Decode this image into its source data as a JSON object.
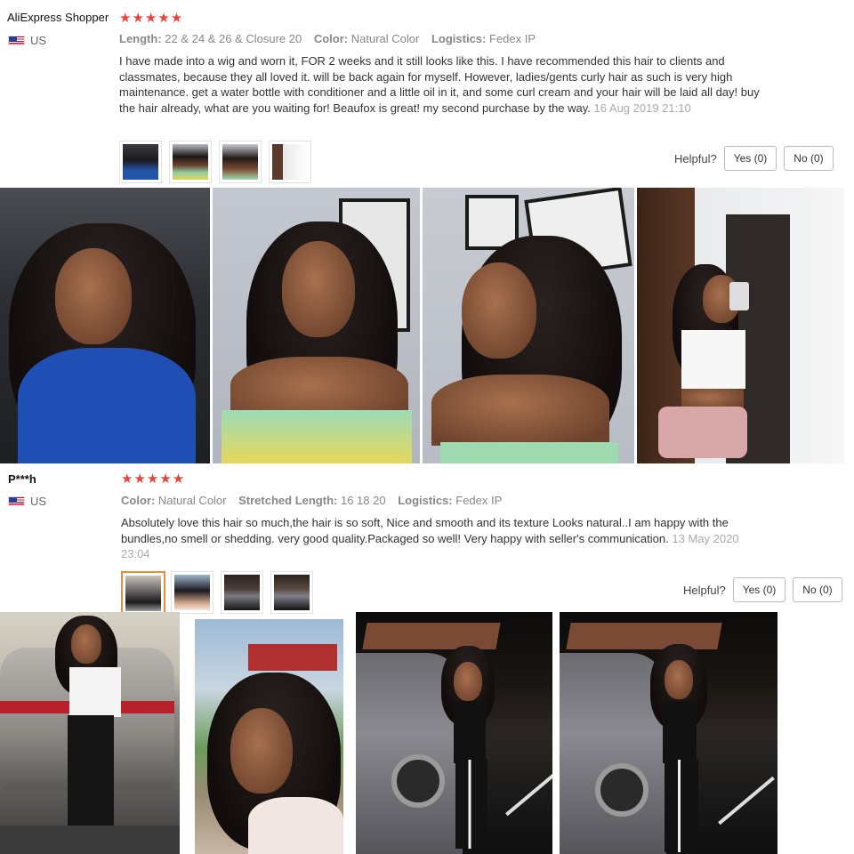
{
  "reviews": [
    {
      "author": "AliExpress Shopper",
      "rating": 5,
      "stars": "★★★★★",
      "country": "US",
      "attrs": [
        {
          "k": "Length:",
          "v": "22 & 24 & 26 & Closure 20"
        },
        {
          "k": "Color:",
          "v": "Natural Color"
        },
        {
          "k": "Logistics:",
          "v": "Fedex IP"
        }
      ],
      "text": "I have made into a wig and worn it, FOR 2 weeks and it still looks like this. I have recommended this hair to clients and classmates, because they all loved it. will be back again for myself. However, ladies/gents curly hair as such is very high maintenance. get a water bottle with conditioner and a little oil in it, and some curl cream and your hair will be laid all day! buy the hair already, what are you waiting for! Beaufox is great! my second purchase by the way.",
      "date": "16 Aug 2019 21:10",
      "helpful_label": "Helpful?",
      "yes_label": "Yes (0)",
      "no_label": "No (0)"
    },
    {
      "author": "P***h",
      "rating": 5,
      "stars": "★★★★★",
      "country": "US",
      "attrs": [
        {
          "k": "Color:",
          "v": "Natural Color"
        },
        {
          "k": "Stretched Length:",
          "v": "16 18 20"
        },
        {
          "k": "Logistics:",
          "v": "Fedex IP"
        }
      ],
      "text": "Absolutely love this hair so much,the hair is so soft, Nice and smooth and its texture Looks natural..I am happy with the bundles,no smell or shedding. very good quality.Packaged so well! Very happy with seller's communication.",
      "date": "13 May 2020 23:04",
      "helpful_label": "Helpful?",
      "yes_label": "Yes (0)",
      "no_label": "No (0)"
    }
  ],
  "icons": {
    "flag": "us-flag-icon",
    "star": "star-icon"
  },
  "colors": {
    "star": "#e8443b",
    "active_thumb_border": "#e88d40",
    "muted_text": "#888888"
  }
}
